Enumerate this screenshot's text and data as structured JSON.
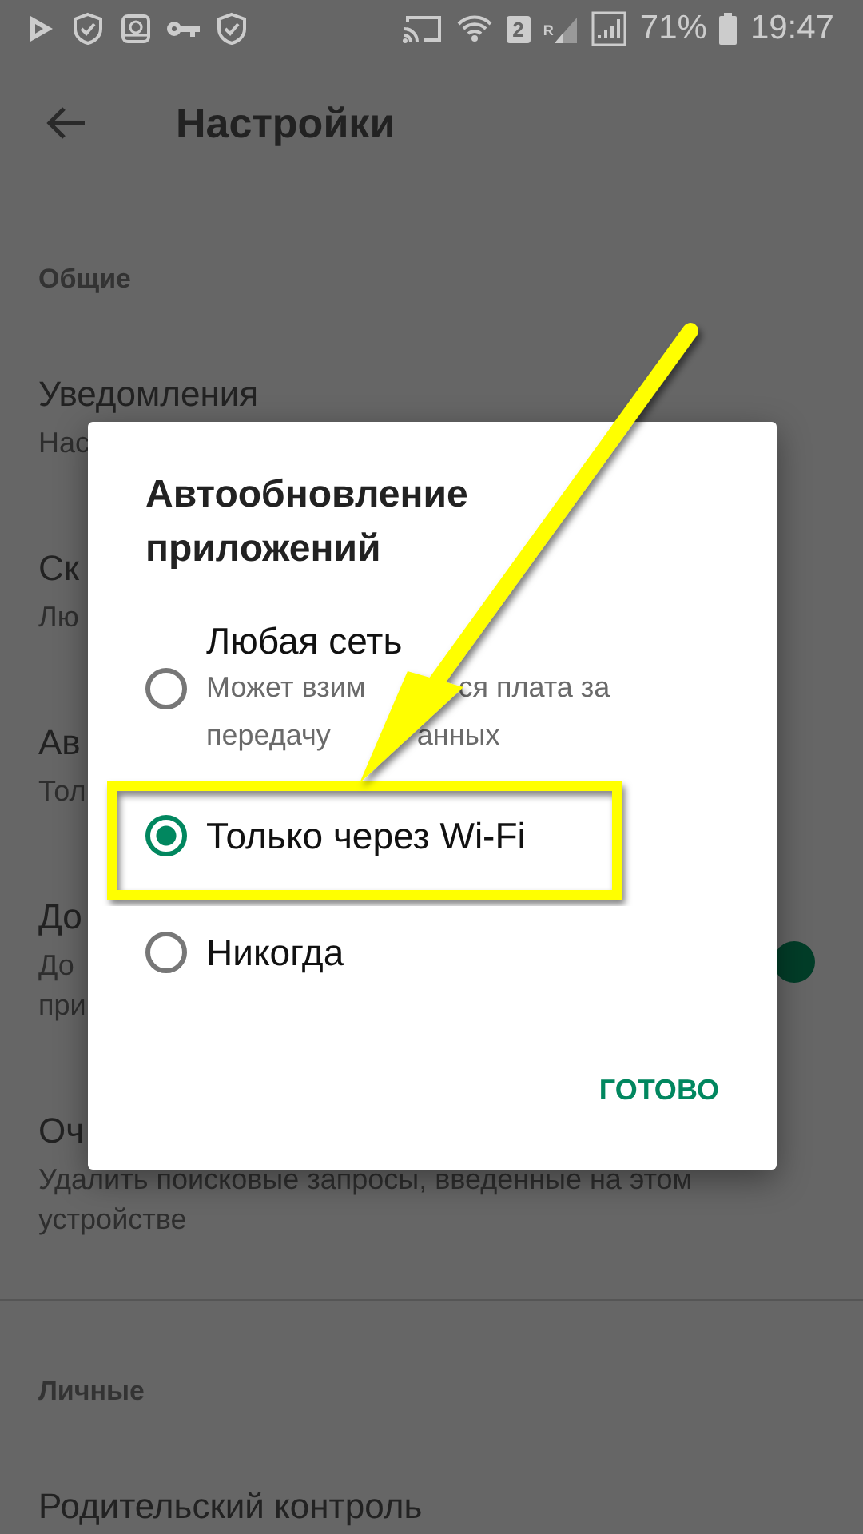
{
  "status_bar": {
    "sim_badge": "2",
    "roaming": "R",
    "battery": "71%",
    "time": "19:47"
  },
  "toolbar": {
    "title": "Настройки"
  },
  "sections": [
    {
      "title": "Общие",
      "items": [
        {
          "kind": "plain",
          "title": "Уведомления",
          "subtitle_lines": [
            "Нас"
          ]
        },
        {
          "kind": "plain",
          "title": "Ск",
          "subtitle_lines": [
            "Лю"
          ]
        },
        {
          "kind": "plain",
          "title": "Ав",
          "subtitle_lines": [
            "Тол"
          ]
        },
        {
          "kind": "toggle",
          "title": "До",
          "subtitle_lines": [
            "До",
            "при"
          ],
          "on": true
        },
        {
          "kind": "plain",
          "title": "Оч",
          "subtitle_lines": [
            "Удалить поисковые запросы, введенные на этом",
            "устройстве"
          ]
        }
      ]
    },
    {
      "title": "Личные",
      "items": [
        {
          "kind": "plain",
          "title": "Родительский контроль"
        }
      ]
    }
  ],
  "dialog": {
    "title": "Автообновление приложений",
    "options": [
      {
        "label": "Любая сеть",
        "description_lines": [
          [
            "Может взим",
            "ся плата за"
          ],
          [
            "передачу",
            "анных"
          ]
        ],
        "selected": false
      },
      {
        "label": "Только через Wi-Fi",
        "selected": true
      },
      {
        "label": "Никогда",
        "selected": false
      }
    ],
    "button": "ГОТОВО"
  }
}
